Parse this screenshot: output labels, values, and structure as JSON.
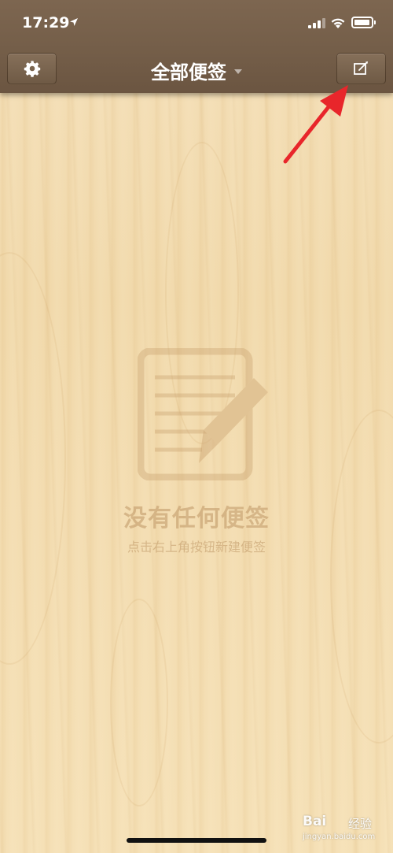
{
  "status_bar": {
    "time": "17:29",
    "icons": [
      "location-arrow-icon",
      "cellular-signal-icon",
      "wifi-icon",
      "battery-icon"
    ]
  },
  "nav_bar": {
    "title": "全部便签",
    "left_button_icon": "gear-icon",
    "right_button_icon": "compose-icon"
  },
  "empty_state": {
    "icon": "note-pencil-icon",
    "title": "没有任何便签",
    "subtitle": "点击右上角按钮新建便签"
  },
  "annotation": {
    "arrow_color": "#e8262b"
  },
  "watermark": {
    "brand": "Bai",
    "brand_suffix": "经验",
    "url": "jingyan.baidu.com"
  },
  "colors": {
    "nav_bar": "#735d48",
    "background": "#f3dcb0",
    "empty_text": "#c8a070"
  }
}
